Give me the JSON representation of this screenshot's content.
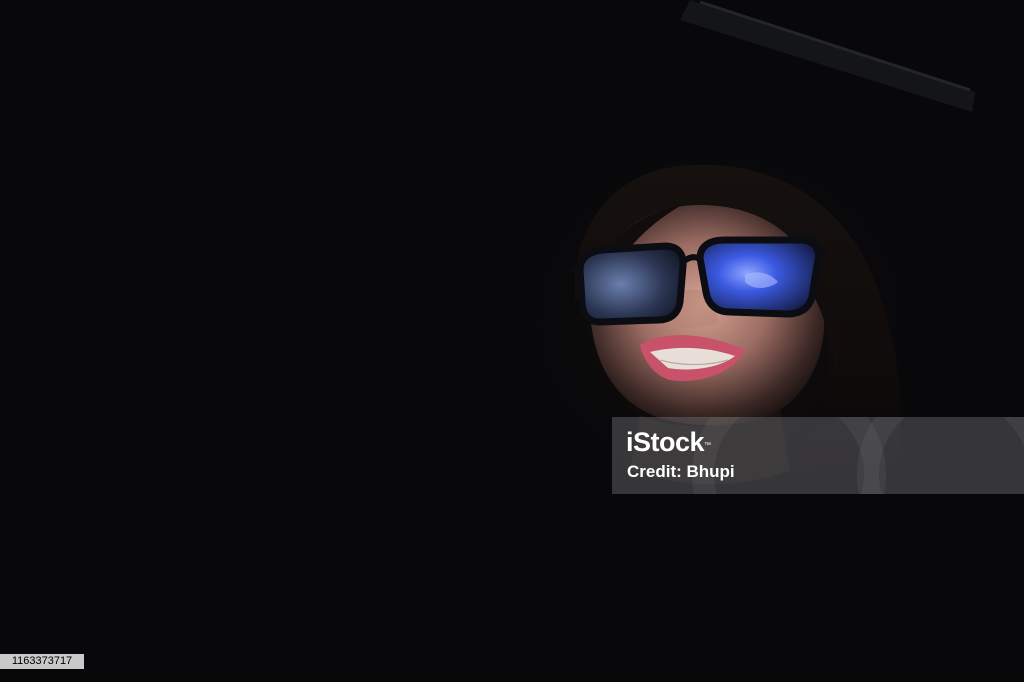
{
  "watermark": {
    "logo_text": "iStock",
    "trademark": "™",
    "credit": "Credit: Bhupi"
  },
  "image_id": "1163373717",
  "colors": {
    "background": "#08080a",
    "skin_highlight": "#d8a99a",
    "lip": "#c7526a",
    "glasses_frame": "#0b0d12",
    "lens_reflection": "#3d62e0"
  }
}
